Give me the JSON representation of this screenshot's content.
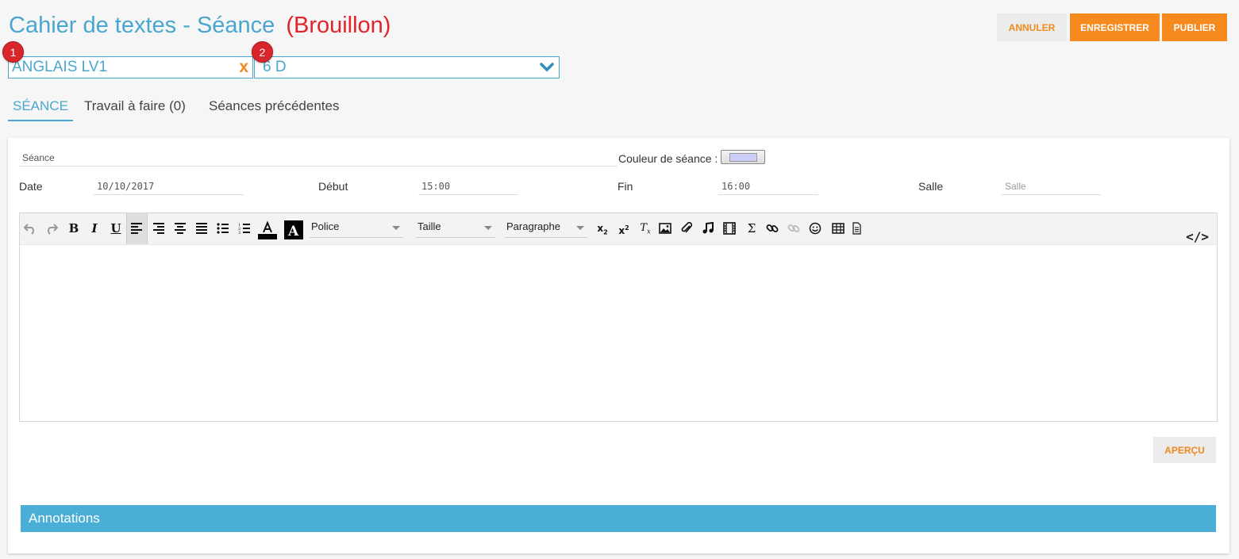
{
  "header": {
    "title": "Cahier de textes - Séance",
    "status": "(Brouillon)"
  },
  "actions": {
    "cancel": "ANNULER",
    "save": "ENREGISTRER",
    "publish": "PUBLIER"
  },
  "badges": [
    "1",
    "2"
  ],
  "selectors": {
    "subject": "ANGLAIS LV1",
    "subject_clear": "x",
    "class": "6 D"
  },
  "tabs": [
    {
      "label": "SÉANCE",
      "active": true
    },
    {
      "label": "Travail à faire (0)",
      "active": false
    },
    {
      "label": "Séances précédentes",
      "active": false
    }
  ],
  "form": {
    "seance_placeholder": "Séance",
    "couleur_label": "Couleur de séance :",
    "couleur_value": "#cccdf7",
    "date_label": "Date",
    "date_value": "10/10/2017",
    "debut_label": "Début",
    "debut_value": "15:00",
    "fin_label": "Fin",
    "fin_value": "16:00",
    "salle_label": "Salle",
    "salle_placeholder": "Salle"
  },
  "editor": {
    "font_select": "Police",
    "size_select": "Taille",
    "format_select": "Paragraphe",
    "tools": [
      "undo-icon",
      "redo-icon",
      "bold",
      "italic",
      "underline",
      "align-left",
      "align-right",
      "align-center",
      "align-justify",
      "bullet-list",
      "numbered-list",
      "text-color",
      "background-color",
      "subscript",
      "superscript",
      "clear-format",
      "image",
      "attachment",
      "audio",
      "video",
      "formula",
      "link",
      "unlink",
      "emoji",
      "table",
      "template",
      "source-code"
    ]
  },
  "preview_button": "APERÇU",
  "annotations_title": "Annotations",
  "colors": {
    "accent": "#4aa6cf",
    "orange": "#f68a1e",
    "draft_red": "#e3232a",
    "annotations_bar": "#4aaed6"
  }
}
